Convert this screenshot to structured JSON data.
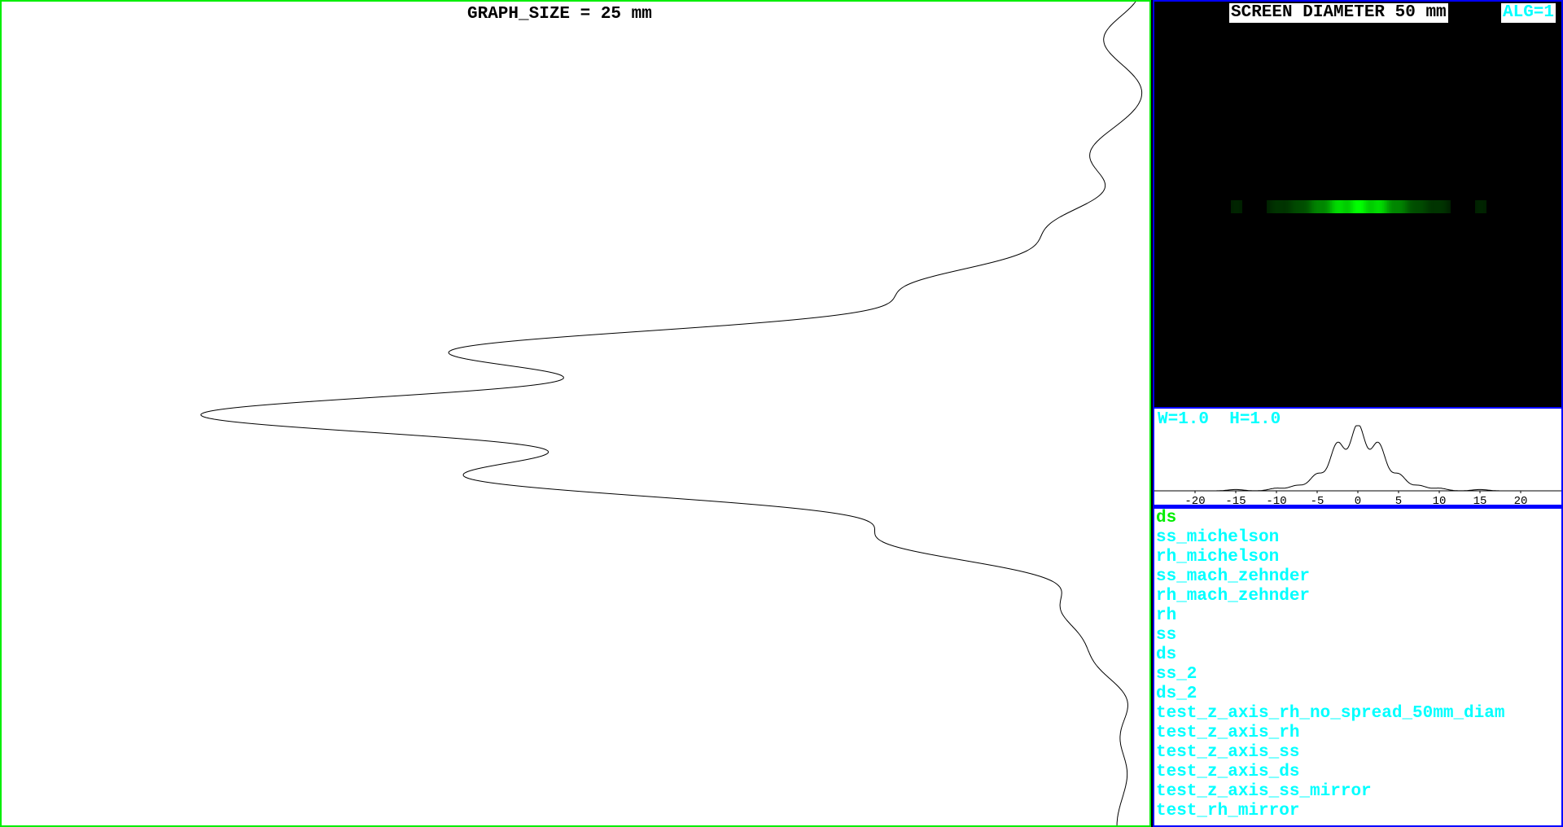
{
  "graph": {
    "title": "GRAPH_SIZE = 25 mm"
  },
  "screen": {
    "title": "SCREEN DIAMETER 50 mm",
    "alg_label": "ALG=1"
  },
  "profile": {
    "label": "W=1.0  H=1.0",
    "ticks": [
      "-20",
      "-15",
      "-10",
      "-5",
      "0",
      "5",
      "10",
      "15",
      "20"
    ]
  },
  "scenes": {
    "items": [
      "ds",
      "ss_michelson",
      "rh_michelson",
      "ss_mach_zehnder",
      "rh_mach_zehnder",
      "rh",
      "ss",
      "ds",
      "ss_2",
      "ds_2",
      "test_z_axis_rh_no_spread_50mm_diam",
      "test_z_axis_rh",
      "test_z_axis_ss",
      "test_z_axis_ds",
      "test_z_axis_ss_mirror",
      "test_rh_mirror"
    ],
    "active_index": 0
  },
  "colors": {
    "border_green": "#00ee00",
    "border_blue": "#0000ff",
    "text_cyan": "#00ffff",
    "active_green": "#00ee00",
    "fringe_green": "#00ff00"
  },
  "chart_data": {
    "type": "line",
    "description_units": "mm",
    "xlim": [
      -25,
      25
    ],
    "peak_positions_mm": [
      -15,
      -10,
      -7.5,
      -5,
      -2.5,
      0,
      2.5,
      5,
      7.5,
      10,
      15
    ],
    "peak_relative_intensity": [
      0.02,
      0.04,
      0.08,
      0.25,
      0.72,
      1.0,
      0.72,
      0.25,
      0.08,
      0.04,
      0.02
    ]
  }
}
